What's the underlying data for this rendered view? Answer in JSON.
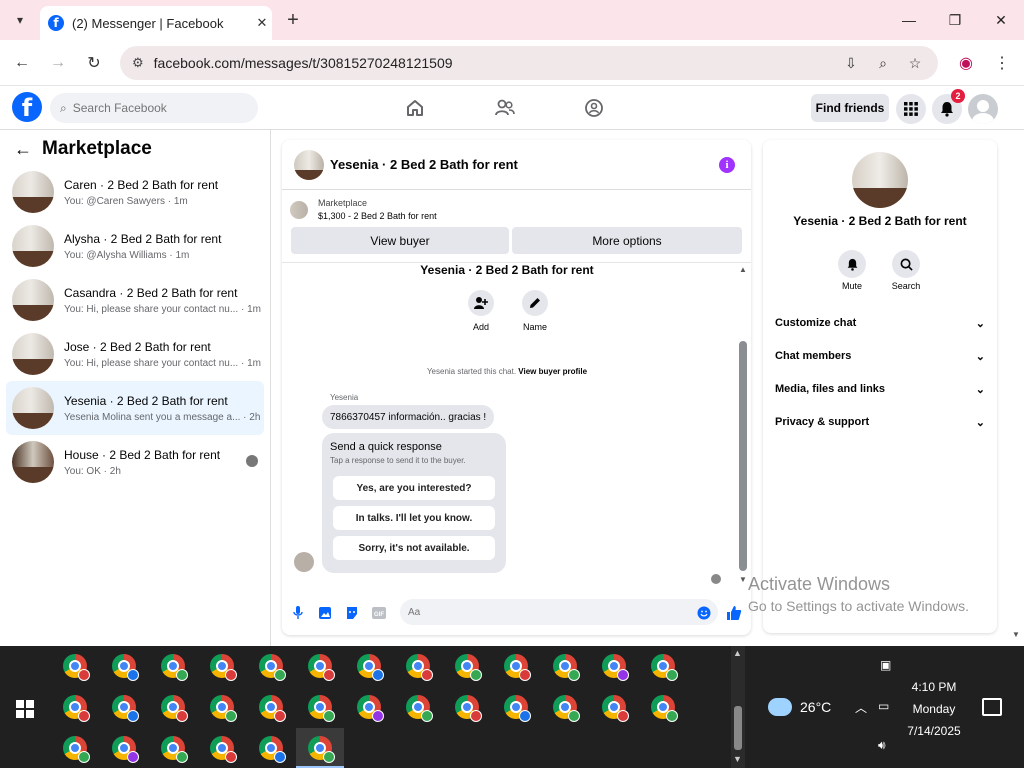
{
  "browser": {
    "tab_title": "(2) Messenger | Facebook",
    "url": "facebook.com/messages/t/30815270248121509",
    "new_tab": "+",
    "tab_close": "✕"
  },
  "fb": {
    "logo": "f",
    "search_placeholder": "Search Facebook",
    "find_friends": "Find friends",
    "notif_count": "2"
  },
  "sidebar": {
    "title": "Marketplace",
    "items": [
      {
        "name": "Caren · 2 Bed 2 Bath for rent",
        "sub": "You: @Caren Sawyers · 1m"
      },
      {
        "name": "Alysha · 2 Bed 2 Bath for rent",
        "sub": "You: @Alysha Williams · 1m"
      },
      {
        "name": "Casandra · 2 Bed 2 Bath for rent",
        "sub": "You: Hi, please share your contact nu... · 1m"
      },
      {
        "name": "Jose · 2 Bed 2 Bath for rent",
        "sub": "You: Hi, please share your contact nu... · 1m"
      },
      {
        "name": "Yesenia · 2 Bed 2 Bath for rent",
        "sub": "Yesenia Molina sent you a message a... · 2h"
      },
      {
        "name": "House · 2 Bed 2 Bath for rent",
        "sub": "You: OK · 2h"
      }
    ]
  },
  "chat": {
    "title": "Yesenia · 2 Bed 2 Bath for rent",
    "listing_source": "Marketplace",
    "listing_price": "$1,300 - 2 Bed 2 Bath for rent",
    "view_buyer": "View buyer",
    "more_options": "More options",
    "conv_title": "Yesenia · 2 Bed 2 Bath for rent",
    "add_label": "Add",
    "name_label": "Name",
    "started_text": "Yesenia started this chat.",
    "view_buyer_profile": "View buyer profile",
    "sender": "Yesenia",
    "message": "7866370457 información.. gracias !",
    "quick_title": "Send a quick response",
    "quick_sub": "Tap a response to send it to the buyer.",
    "quick_replies": [
      "Yes, are you interested?",
      "In talks. I'll let you know.",
      "Sorry, it's not available."
    ],
    "composer_placeholder": "Aa"
  },
  "info_panel": {
    "name": "Yesenia · 2 Bed 2 Bath for rent",
    "mute": "Mute",
    "search": "Search",
    "sections": [
      "Customize chat",
      "Chat members",
      "Media, files and links",
      "Privacy & support"
    ]
  },
  "watermark": {
    "line1": "Activate Windows",
    "line2": "Go to Settings to activate Windows."
  },
  "taskbar": {
    "temperature": "26°C",
    "time": "4:10 PM",
    "day": "Monday",
    "date": "7/14/2025"
  },
  "colors": {
    "fb_blue": "#0866ff",
    "accent_purple": "#a033ff",
    "badge_red": "#e41e3f",
    "like_blue": "#0866ff"
  }
}
